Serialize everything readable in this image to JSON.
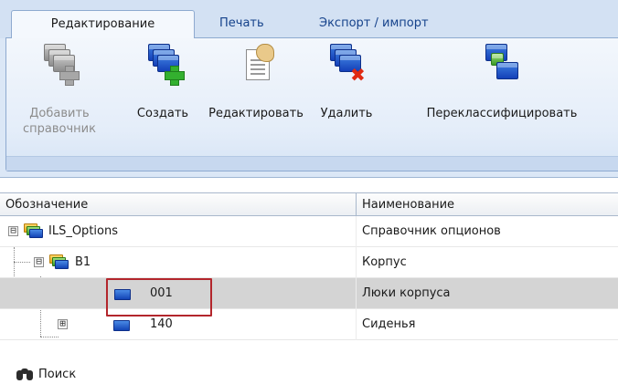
{
  "tabs": [
    {
      "label": "Редактирование",
      "active": true
    },
    {
      "label": "Печать",
      "active": false
    },
    {
      "label": "Экспорт / импорт",
      "active": false
    }
  ],
  "ribbon_buttons": {
    "add": {
      "label_line1": "Добавить",
      "label_line2": "справочник",
      "enabled": false,
      "icon": "add-catalog-icon"
    },
    "create": {
      "label": "Создать",
      "icon": "create-icon"
    },
    "edit": {
      "label": "Редактировать",
      "icon": "edit-document-icon"
    },
    "delete": {
      "label": "Удалить",
      "icon": "delete-icon"
    },
    "reclassify": {
      "label": "Переклассифицировать",
      "icon": "reclassify-icon"
    }
  },
  "grid": {
    "columns": [
      "Обозначение",
      "Наименование"
    ],
    "rows": [
      {
        "designation": "ILS_Options",
        "name": "Справочник опционов",
        "level": 0,
        "expander": "⊟",
        "icon": "folder-stack-icon",
        "selected": false
      },
      {
        "designation": "B1",
        "name": "Корпус",
        "level": 1,
        "expander": "⊟",
        "icon": "folder-stack-icon",
        "selected": false
      },
      {
        "designation": "001",
        "name": "Люки корпуса",
        "level": 2,
        "expander": "",
        "icon": "window-icon",
        "selected": true
      },
      {
        "designation": "140",
        "name": "Сиденья",
        "level": 2,
        "expander": "⊞",
        "icon": "window-icon",
        "selected": false
      }
    ]
  },
  "search": {
    "label": "Поиск",
    "icon": "binoculars-icon"
  },
  "colors": {
    "ribbon_bg": "#dbe7f6",
    "tab_text": "#15428b",
    "selected_row": "#d4d4d4",
    "highlight_box": "#b3262c",
    "disabled_text": "#8c8c8c"
  }
}
